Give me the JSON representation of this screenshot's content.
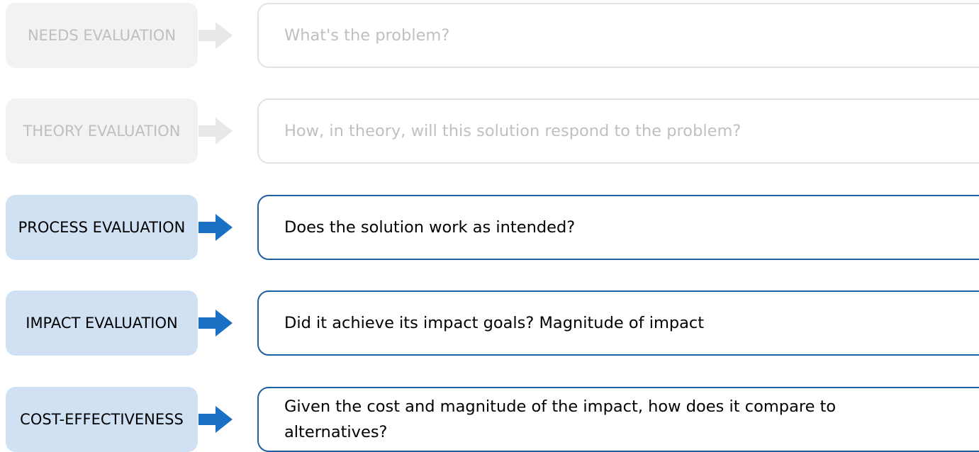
{
  "colors": {
    "inactive_stage_bg": "#f2f2f2",
    "inactive_text": "#bfbfbf",
    "active_stage_bg": "#cfe1f3",
    "active_arrow": "#1a70c4",
    "active_border": "#1e5fa3"
  },
  "rows": [
    {
      "stage": "NEEDS EVALUATION",
      "question": "What's the problem?",
      "active": false
    },
    {
      "stage": "THEORY EVALUATION",
      "question": "How, in theory, will this solution respond to the problem?",
      "active": false
    },
    {
      "stage": "PROCESS EVALUATION",
      "question": "Does the solution work as intended?",
      "active": true
    },
    {
      "stage": "IMPACT EVALUATION",
      "question": "Did it achieve its impact goals? Magnitude of impact",
      "active": true
    },
    {
      "stage": "COST-EFFECTIVENESS",
      "question": "Given the cost and magnitude of the impact, how does it compare to alternatives?",
      "active": true
    }
  ]
}
